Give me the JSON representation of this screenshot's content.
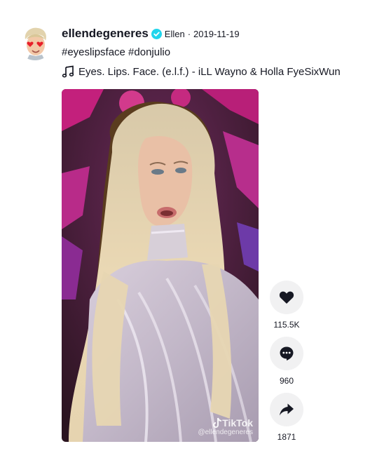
{
  "post": {
    "username": "ellendegeneres",
    "nickname": "Ellen",
    "separator": "·",
    "date": "2019-11-19",
    "caption": "#eyeslipsface #donjulio",
    "music": "Eyes. Lips. Face. (e.l.f.) - iLL Wayno & Holla FyeSixWun",
    "watermark_brand": "TikTok",
    "watermark_handle": "@ellendegeneres"
  },
  "actions": {
    "like_count": "115.5K",
    "comment_count": "960",
    "share_count": "1871"
  },
  "colors": {
    "verified": "#20D5EC",
    "text": "#161823",
    "action_bg": "#f1f1f2"
  },
  "icons": {
    "avatar": "avatar-cartoon",
    "verified": "verified-badge-icon",
    "music": "music-note-icon",
    "like": "heart-icon",
    "comment": "comment-bubble-icon",
    "share": "share-arrow-icon"
  }
}
